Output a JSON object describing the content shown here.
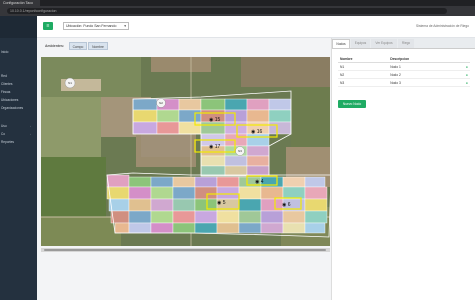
{
  "browser": {
    "tab_title": "Configuración Taco",
    "address": "10.10.0.1/report/configuracion"
  },
  "sidebar": {
    "items": [
      {
        "label": "Inicio",
        "chevron": false
      },
      {
        "label": "Red",
        "chevron": false
      },
      {
        "label": "Clientes",
        "chevron": false
      },
      {
        "label": "Fincas",
        "chevron": false
      },
      {
        "label": "Ubicaciones",
        "chevron": false
      },
      {
        "label": "Organizaciones",
        "chevron": false
      },
      {
        "label": "Usu",
        "chevron": true
      },
      {
        "label": "Co",
        "chevron": true
      },
      {
        "label": "Reportes",
        "chevron": false
      }
    ]
  },
  "topbar": {
    "menu_icon": "hamburger-icon",
    "location_select": "Ubicación: Fundo San Fernando",
    "system_title": "Sistema de Administración de Riego"
  },
  "filters": {
    "label": "Ambientes:",
    "buttons": [
      "Campo",
      "Nombre"
    ]
  },
  "map": {
    "lot_labels": [
      "15",
      "16",
      "17",
      "4",
      "5",
      "6"
    ],
    "markers": [
      "N1",
      "N2",
      "N3"
    ]
  },
  "panel": {
    "tabs": [
      "Nodos",
      "Equipos",
      "Ver Equipos",
      "Riego"
    ],
    "active_tab": 0,
    "columns": [
      "Nombre",
      "Descripcion"
    ],
    "rows": [
      {
        "name": "N1",
        "desc": "Nodo 1"
      },
      {
        "name": "N2",
        "desc": "Nodo 2"
      },
      {
        "name": "N3",
        "desc": "Nodo 3"
      }
    ],
    "new_button": "Nuevo Nodo"
  },
  "colors": {
    "accent": "#1fab63",
    "sidebar": "#24313f",
    "highlight": "#f2ea00"
  }
}
